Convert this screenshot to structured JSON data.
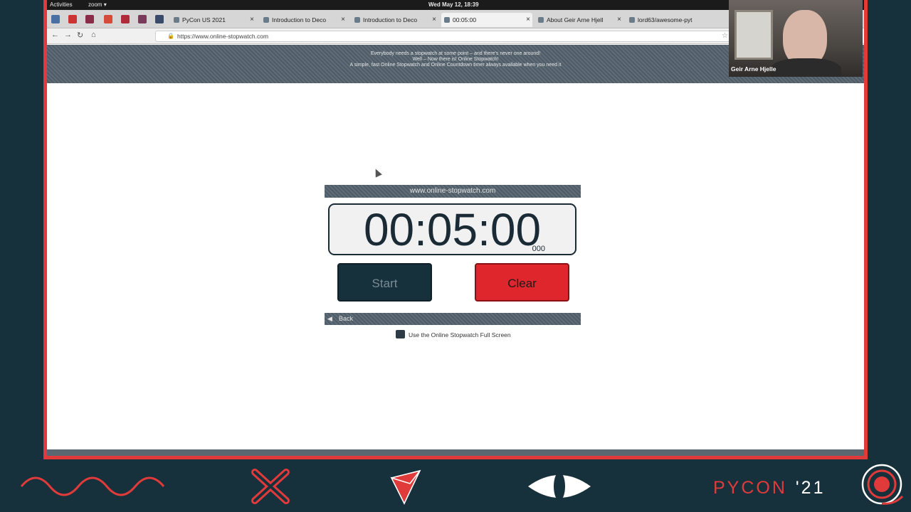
{
  "topbar": {
    "activities": "Activities",
    "app": "zoom ▾",
    "clock": "Wed May 12, 18:39"
  },
  "tabs": [
    {
      "label": "PyCon US 2021"
    },
    {
      "label": "Introduction to Deco"
    },
    {
      "label": "Introduction to Deco"
    },
    {
      "label": "00:05:00"
    },
    {
      "label": "About Geir Arne Hjell"
    },
    {
      "label": "lord63/awesome-pyt"
    }
  ],
  "nav": {
    "url": "https://www.online-stopwatch.com"
  },
  "site_header": {
    "line1": "Everybody needs a stopwatch at some point – and there's never one around!",
    "line2": "Well – Now there is! Online Stopwatch!",
    "line3": "A simple, fast Online Stopwatch and Online Countdown timer always available when you need it"
  },
  "stopwatch": {
    "domain_label": "www.online-stopwatch.com",
    "time": "00:05:00",
    "milliseconds": "000",
    "start_label": "Start",
    "clear_label": "Clear",
    "back_label": "Back",
    "fullscreen_label": "Use the Online Stopwatch Full Screen"
  },
  "webcam": {
    "name": "Geir Arne Hjelle"
  },
  "pycon": {
    "wordmark": "PYCON",
    "year": "'21"
  },
  "colors": {
    "frame": "#e03a3a",
    "background": "#17313c",
    "clear_button": "#e0262d",
    "start_button": "#17313c"
  }
}
